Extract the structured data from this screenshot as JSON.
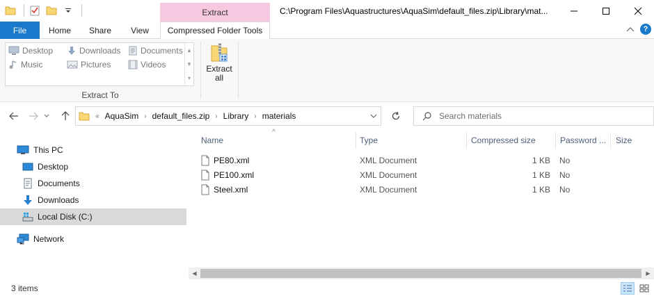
{
  "window": {
    "title": "C:\\Program Files\\Aquastructures\\AquaSim\\default_files.zip\\Library\\mat...",
    "context_tab_group": "Extract"
  },
  "ribbon": {
    "tabs": [
      "File",
      "Home",
      "Share",
      "View",
      "Compressed Folder Tools"
    ],
    "extract_to": {
      "items": [
        "Desktop",
        "Downloads",
        "Documents",
        "Music",
        "Pictures",
        "Videos"
      ],
      "group_label": "Extract To"
    },
    "extract_all": {
      "line1": "Extract",
      "line2": "all"
    },
    "help": "?"
  },
  "address": {
    "overflow": "«",
    "crumbs": [
      "AquaSim",
      "default_files.zip",
      "Library",
      "materials"
    ]
  },
  "search": {
    "placeholder": "Search materials"
  },
  "nav_pane": {
    "items": [
      "This PC",
      "Desktop",
      "Documents",
      "Downloads",
      "Local Disk (C:)",
      "Network"
    ]
  },
  "columns": [
    "Name",
    "Type",
    "Compressed size",
    "Password ...",
    "Size"
  ],
  "files": [
    {
      "name": "PE80.xml",
      "type": "XML Document",
      "compressed_size": "1 KB",
      "password": "No"
    },
    {
      "name": "PE100.xml",
      "type": "XML Document",
      "compressed_size": "1 KB",
      "password": "No"
    },
    {
      "name": "Steel.xml",
      "type": "XML Document",
      "compressed_size": "1 KB",
      "password": "No"
    }
  ],
  "status": {
    "item_count": "3 items"
  },
  "colors": {
    "accent": "#1979ca",
    "context_tab": "#f8c8e0",
    "selection": "#d9d9d9",
    "header_text": "#4c607a"
  }
}
